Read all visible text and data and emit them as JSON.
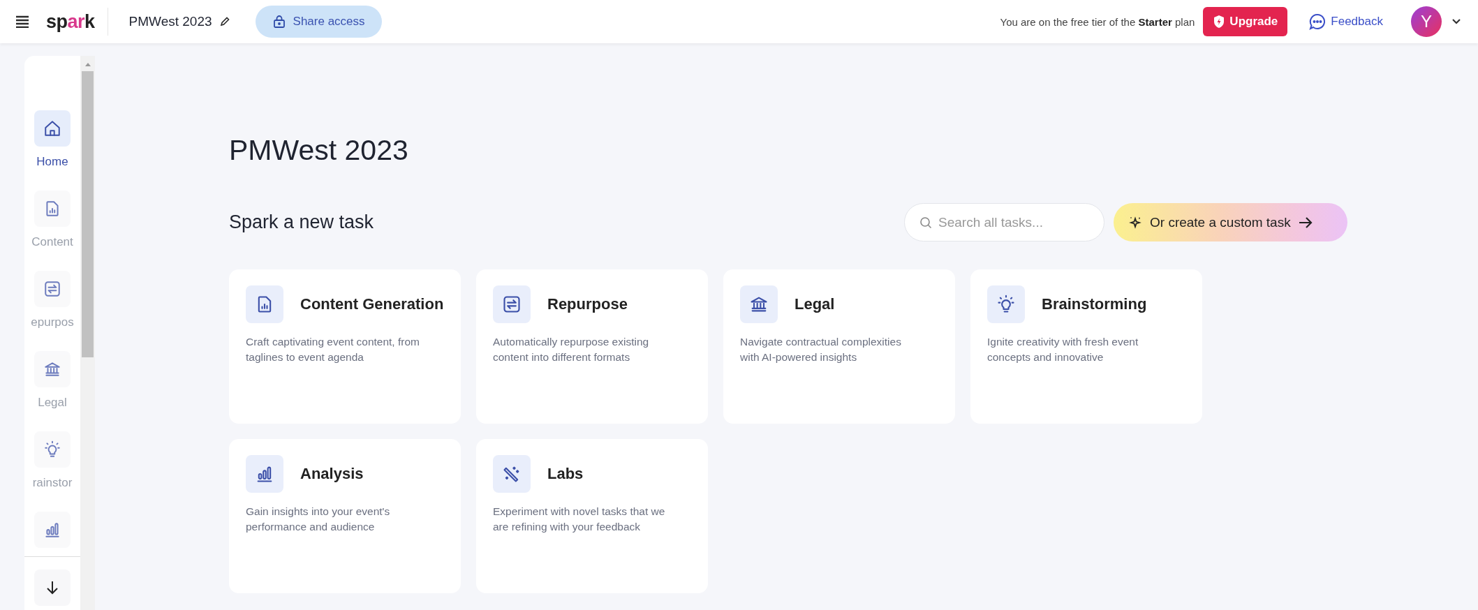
{
  "topbar": {
    "brand": "spark",
    "project": "PMWest 2023",
    "share_button": "Share access",
    "plan_notice": "You are on the free tier of the **Starter** plan",
    "upgrade_button": "Upgrade",
    "feedback_link": "Feedback",
    "avatar": "Y"
  },
  "sidebar": {
    "items": [
      {
        "label": "Home",
        "selected": true
      },
      {
        "label": "Content",
        "selected": false
      },
      {
        "label": "epurpos",
        "selected": false
      },
      {
        "label": "Legal",
        "selected": false
      },
      {
        "label": "rainstor",
        "selected": false
      },
      {
        "selected": false
      }
    ]
  },
  "main": {
    "title": "PMWest 2023",
    "section_title": "Spark a new task",
    "search": {
      "placeholder": "Search all tasks..."
    },
    "custom_task_button": "Or create a custom task",
    "cards": [
      {
        "title": "Content Generation",
        "description": "Craft captivating event content, from taglines to event agenda"
      },
      {
        "title": "Repurpose",
        "description": "Automatically repurpose existing content into different formats"
      },
      {
        "title": "Legal",
        "description": "Navigate contractual complexities with AI-powered insights"
      },
      {
        "title": "Brainstorming",
        "description": "Ignite creativity with fresh event concepts and innovative"
      },
      {
        "title": "Analysis",
        "description": "Gain insights into your event's performance and audience"
      },
      {
        "title": "Labs",
        "description": "Experiment with novel tasks that we are refining with your feedback"
      }
    ]
  }
}
